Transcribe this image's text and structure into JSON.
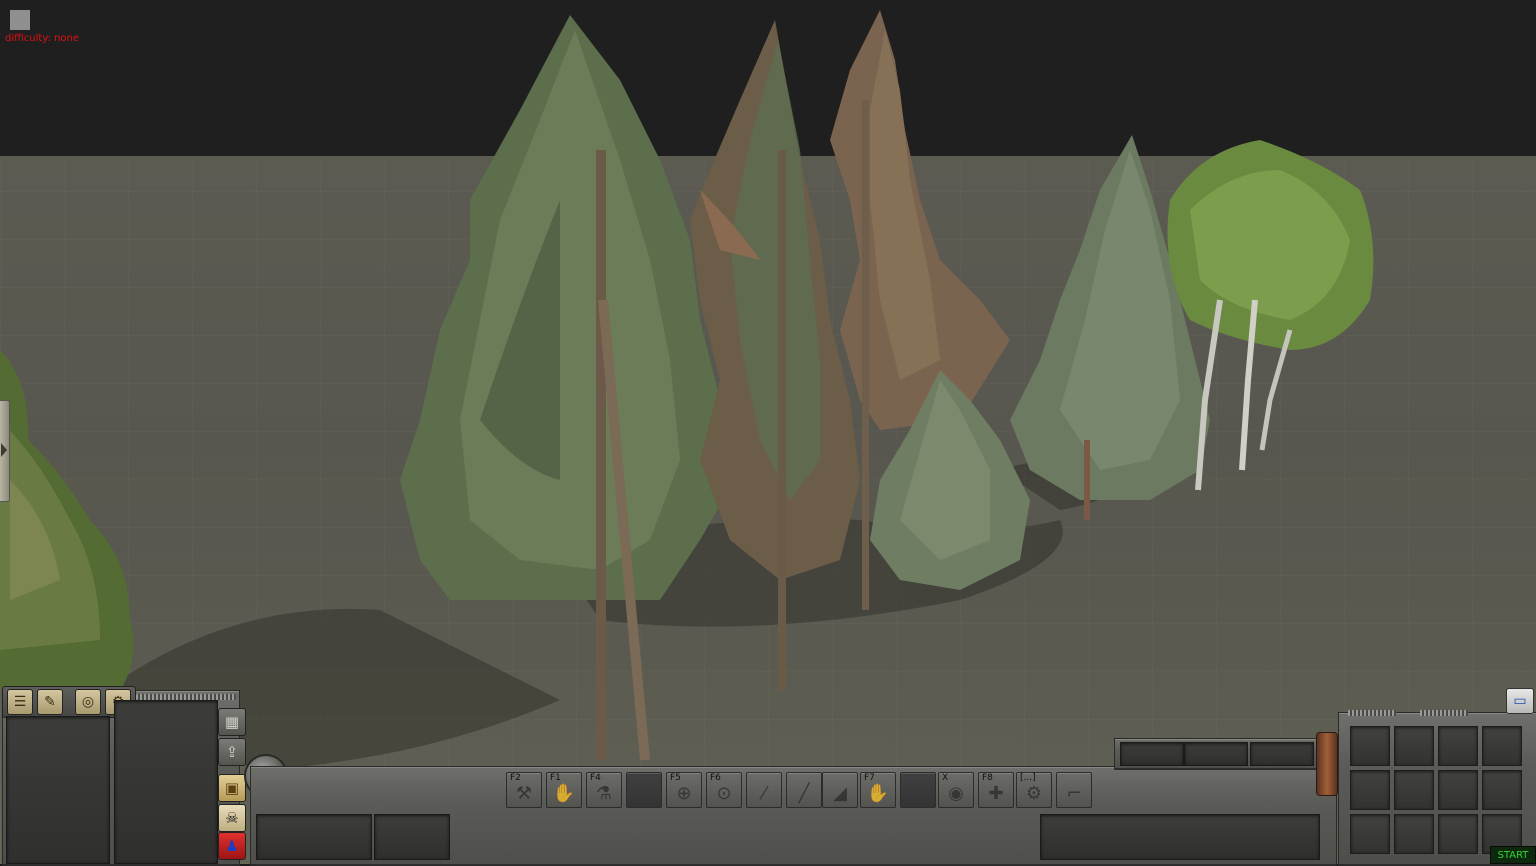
{
  "debug": {
    "difficulty_text": "difficulty: none"
  },
  "left_panel": {
    "toolbar_icons": [
      "journal-icon",
      "pencil-icon",
      "compass-icon",
      "wrench-icon"
    ],
    "side_buttons": [
      "grid-icon",
      "map-icon",
      "crate-icon",
      "skull-icon",
      "red-squad-icon"
    ]
  },
  "hotbar": {
    "slots": [
      {
        "key": "F2",
        "icon": "shovel-icon",
        "glyph": "⚒"
      },
      {
        "key": "F1",
        "icon": "grenade-icon",
        "glyph": "✋"
      },
      {
        "key": "F4",
        "icon": "tool-icon",
        "glyph": "⚗"
      },
      {
        "key": "",
        "icon": "",
        "glyph": "",
        "empty": true
      },
      {
        "key": "F5",
        "icon": "crosshair-icon",
        "glyph": "⊕"
      },
      {
        "key": "F6",
        "icon": "binoculars-icon",
        "glyph": "⊙"
      },
      {
        "key": "",
        "icon": "knife-icon",
        "glyph": "⁄"
      },
      {
        "key": "",
        "icon": "rifle-icon",
        "glyph": "╱"
      },
      {
        "key": "",
        "icon": "boot-icon",
        "glyph": "◢"
      },
      {
        "key": "F7",
        "icon": "hand-icon",
        "glyph": "✋"
      },
      {
        "key": "",
        "icon": "",
        "glyph": "",
        "empty": true
      },
      {
        "key": "X",
        "icon": "eye-icon",
        "glyph": "◉"
      },
      {
        "key": "F8",
        "icon": "plus-icon",
        "glyph": "✚"
      },
      {
        "key": "[...]",
        "icon": "wrench-icon",
        "glyph": "⚙"
      },
      {
        "key": "",
        "icon": "pistol-icon",
        "glyph": "⌐"
      }
    ]
  },
  "inventory": {
    "rows": 3,
    "cols": 4
  },
  "start_label": "START",
  "colors": {
    "sky": "#1f1f1f",
    "ground": "#5a5a50",
    "debug_text": "#e01010",
    "start_text": "#33d23a"
  }
}
